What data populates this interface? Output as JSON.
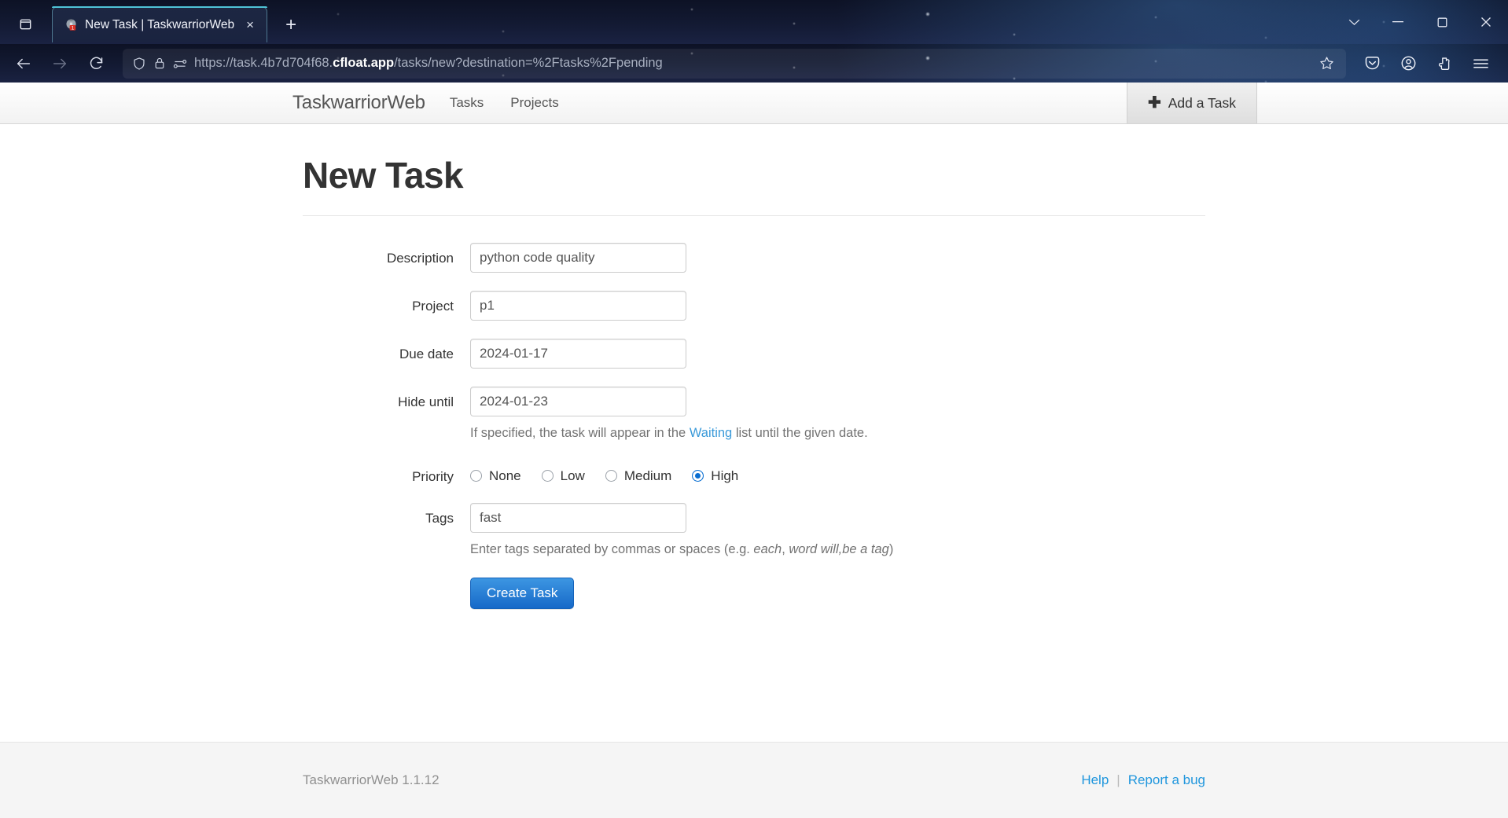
{
  "browser": {
    "tab": {
      "title": "New Task | TaskwarriorWeb",
      "favicon_name": "taskwarrior-favicon",
      "close_label": "×"
    },
    "new_tab_label": "+",
    "window_controls": {
      "minimize": "—",
      "maximize": "❐",
      "close": "✕",
      "chevron": "⌄"
    },
    "url": {
      "scheme": "https://task.4b7d704f68.",
      "host": "cfloat.app",
      "path": "/tasks/new?destination=%2Ftasks%2Fpending",
      "full": "https://task.4b7d704f68.cfloat.app/tasks/new?destination=%2Ftasks%2Fpending"
    },
    "toolbar_icons": [
      "shield-icon",
      "lock-icon",
      "permissions-icon",
      "star-icon",
      "pocket-icon",
      "account-icon",
      "extensions-icon",
      "menu-icon"
    ]
  },
  "app": {
    "brand": "TaskwarriorWeb",
    "nav_links": [
      {
        "label": "Tasks"
      },
      {
        "label": "Projects"
      }
    ],
    "add_task_button": {
      "icon": "plus-icon",
      "label": "Add a Task"
    }
  },
  "main": {
    "page_title": "New Task",
    "form": {
      "description": {
        "label": "Description",
        "value": "python code quality"
      },
      "project": {
        "label": "Project",
        "value": "p1"
      },
      "due_date": {
        "label": "Due date",
        "value": "2024-01-17"
      },
      "hide_until": {
        "label": "Hide until",
        "value": "2024-01-23",
        "help_prefix": "If specified, the task will appear in the ",
        "help_link": "Waiting",
        "help_suffix": " list until the given date."
      },
      "priority": {
        "label": "Priority",
        "options": [
          {
            "label": "None",
            "selected": false
          },
          {
            "label": "Low",
            "selected": false
          },
          {
            "label": "Medium",
            "selected": false
          },
          {
            "label": "High",
            "selected": true
          }
        ],
        "selected_value": "High"
      },
      "tags": {
        "label": "Tags",
        "value": "fast",
        "help_prefix": "Enter tags separated by commas or spaces (e.g. ",
        "help_italic_1": "each",
        "help_mid_1": ", ",
        "help_italic_2": "word will,be a tag",
        "help_suffix": ")"
      },
      "submit_label": "Create Task"
    }
  },
  "footer": {
    "version": "TaskwarriorWeb 1.1.12",
    "links": [
      {
        "label": "Help"
      },
      {
        "label": "Report a bug"
      }
    ],
    "separator": "|"
  },
  "colors": {
    "accent_blue": "#1769c8",
    "link_blue": "#1f96dd",
    "radio_selected": "#0a6ed1",
    "chrome_bg": "#0d1225"
  }
}
